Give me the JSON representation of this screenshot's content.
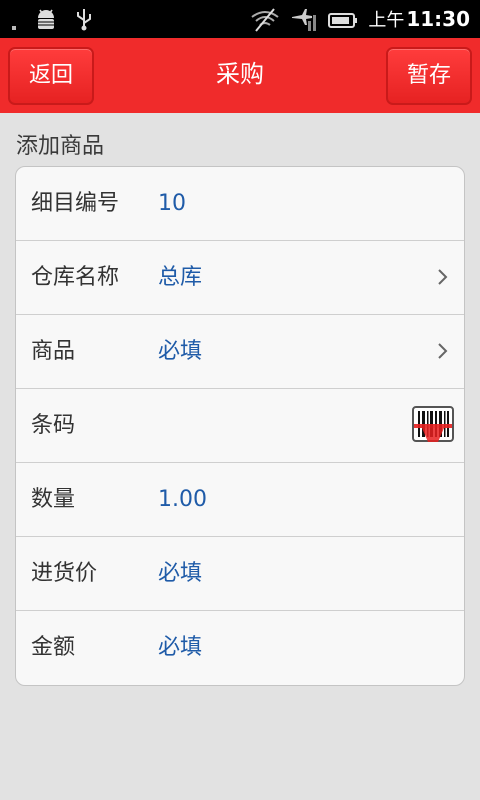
{
  "status_bar": {
    "time_prefix": "上午",
    "time": "11:30",
    "left_icons": [
      "signal-dot-icon",
      "android-debug-icon",
      "usb-icon"
    ],
    "right_icons": [
      "wifi-off-icon",
      "airplane-signal-icon",
      "battery-icon"
    ]
  },
  "header": {
    "back_label": "返回",
    "title": "采购",
    "save_label": "暂存",
    "bg_color": "#f02b2b"
  },
  "section": {
    "title": "添加商品"
  },
  "form": {
    "rows": [
      {
        "label": "细目编号",
        "value": "10"
      },
      {
        "label": "仓库名称",
        "value": "总库"
      },
      {
        "label": "商品",
        "value": "必填"
      },
      {
        "label": "条码",
        "value": ""
      },
      {
        "label": "数量",
        "value": "1.00"
      },
      {
        "label": "进货价",
        "value": "必填"
      },
      {
        "label": "金额",
        "value": "必填"
      }
    ]
  },
  "colors": {
    "value_text": "#1f5ba8",
    "label_text": "#333333",
    "background": "#e2e2e2"
  }
}
